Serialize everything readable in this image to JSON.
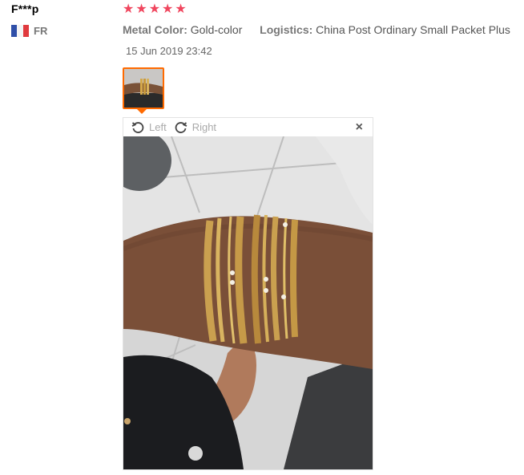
{
  "reviewer": {
    "name": "F***p",
    "country": "FR"
  },
  "rating": {
    "stars": 5,
    "max": 5
  },
  "attributes": [
    {
      "label": "Metal Color:",
      "value": "Gold-color"
    },
    {
      "label": "Logistics:",
      "value": "China Post Ordinary Small Packet Plus"
    }
  ],
  "date": "15 Jun 2019 23:42",
  "viewer": {
    "rotate_left_label": "Left",
    "rotate_right_label": "Right",
    "close_symbol": "×"
  },
  "colors": {
    "star": "#f0465e",
    "thumb_border": "#ff6a00"
  }
}
